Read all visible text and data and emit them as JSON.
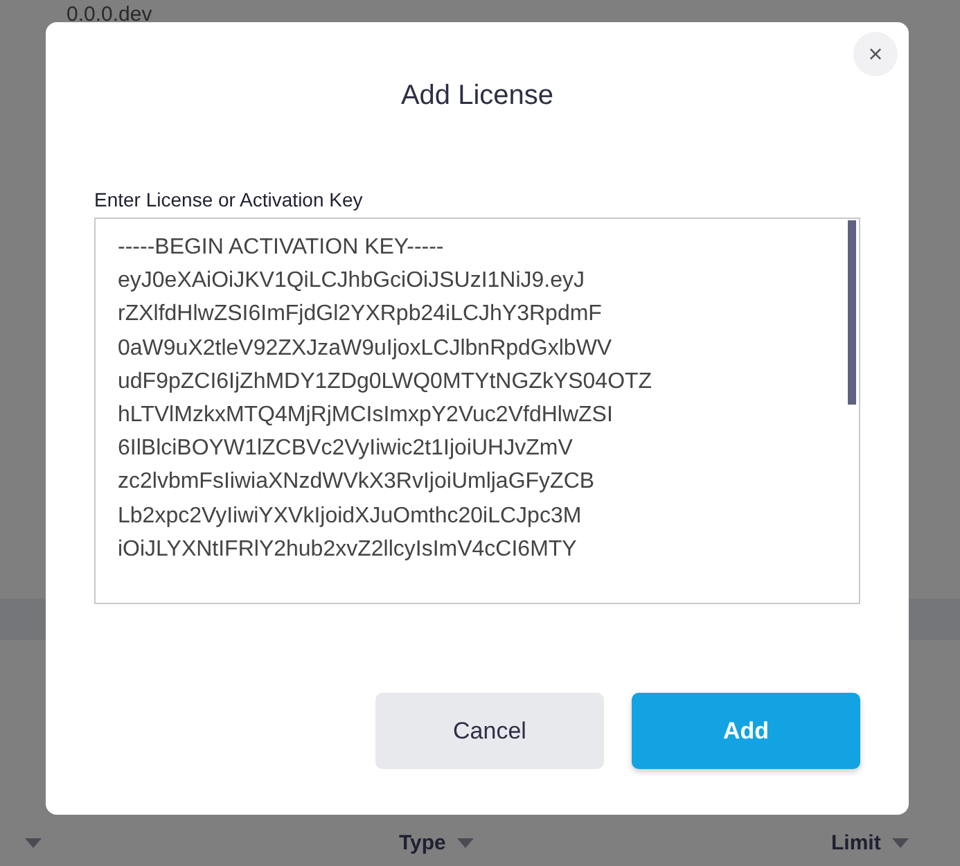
{
  "background_page": {
    "version": "0.0.0.dev",
    "cut_column": {
      "sort_caret": true
    },
    "table_columns": [
      {
        "label": "Type"
      },
      {
        "label": "Limit"
      }
    ]
  },
  "dialog": {
    "title": "Add License",
    "close_icon": "×",
    "field_label": "Enter License or Activation Key",
    "key_lines": [
      "-----BEGIN ACTIVATION KEY-----",
      "eyJ0eXAiOiJKV1QiLCJhbGciOiJSUzI1NiJ9.eyJ",
      "rZXlfdHlwZSI6ImFjdGl2YXRpb24iLCJhY3RpdmF",
      "0aW9uX2tleV92ZXJzaW9uIjoxLCJlbnRpdGxlbWV",
      "udF9pZCI6IjZhMDY1ZDg0LWQ0MTYtNGZkYS04OTZ",
      "hLTVlMzkxMTQ4MjRjMCIsImxpY2Vuc2VfdHlwZSI",
      "6IlBlciBOYW1lZCBVc2VyIiwic2t1IjoiUHJvZmV",
      "zc2lvbmFsIiwiaXNzdWVkX3RvIjoiUmljaGFyZCB",
      "Lb2xpc2VyIiwiYXVkIjoidXJuOmthc20iLCJpc3M",
      "iOiJLYXNtIFRlY2hub2xvZ2llcyIsImV4cCI6MTY"
    ],
    "buttons": [
      {
        "label": "Cancel",
        "kind": "secondary"
      },
      {
        "label": "Add",
        "kind": "primary"
      }
    ]
  }
}
